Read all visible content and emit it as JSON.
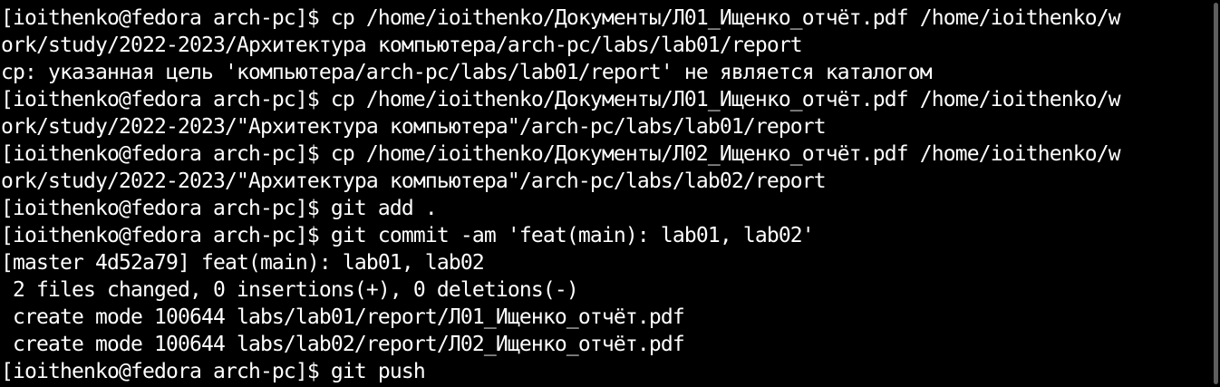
{
  "terminal": {
    "lines": [
      "[ioithenko@fedora arch-pc]$ cp /home/ioithenko/Документы/Л01_Ищенко_отчёт.pdf /home/ioithenko/w",
      "ork/study/2022-2023/Архитектура компьютера/arch-pc/labs/lab01/report",
      "cp: указанная цель 'компьютера/arch-pc/labs/lab01/report' не является каталогом",
      "[ioithenko@fedora arch-pc]$ cp /home/ioithenko/Документы/Л01_Ищенко_отчёт.pdf /home/ioithenko/w",
      "ork/study/2022-2023/\"Архитектура компьютера\"/arch-pc/labs/lab01/report",
      "[ioithenko@fedora arch-pc]$ cp /home/ioithenko/Документы/Л02_Ищенко_отчёт.pdf /home/ioithenko/w",
      "ork/study/2022-2023/\"Архитектура компьютера\"/arch-pc/labs/lab02/report",
      "[ioithenko@fedora arch-pc]$ git add .",
      "[ioithenko@fedora arch-pc]$ git commit -am 'feat(main): lab01, lab02'",
      "[master 4d52a79] feat(main): lab01, lab02",
      " 2 files changed, 0 insertions(+), 0 deletions(-)",
      " create mode 100644 labs/lab01/report/Л01_Ищенко_отчёт.pdf",
      " create mode 100644 labs/lab02/report/Л02_Ищенко_отчёт.pdf",
      "[ioithenko@fedora arch-pc]$ git push"
    ]
  },
  "colors": {
    "background": "#000000",
    "foreground": "#ffffff",
    "scrollbar_thumb": "#5e5e5e"
  }
}
